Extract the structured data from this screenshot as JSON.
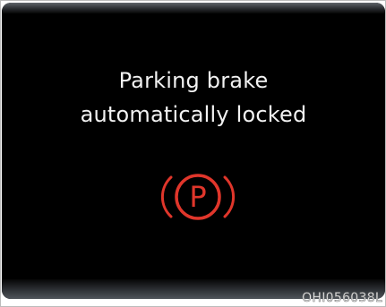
{
  "display": {
    "message_line1": "Parking brake",
    "message_line2": "automatically locked",
    "indicator_icon": "parking-brake-icon",
    "indicator_letter": "P",
    "indicator_color": "#e0362b",
    "text_color": "#f2f2f2",
    "background_color": "#000000"
  },
  "figure_code": "OHI056038L"
}
